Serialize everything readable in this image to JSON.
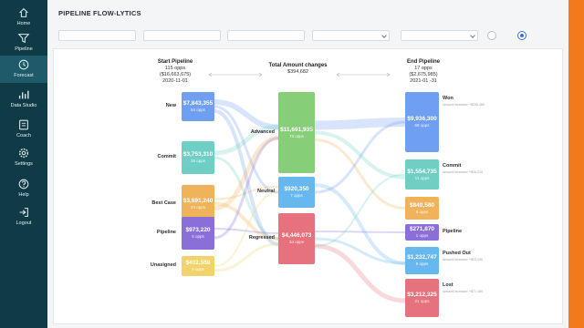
{
  "nav": [
    {
      "label": "Home",
      "icon": "home-icon"
    },
    {
      "label": "Pipeline",
      "icon": "filter-icon"
    },
    {
      "label": "Forecast",
      "icon": "clock-icon",
      "active": true
    },
    {
      "label": "Data Studio",
      "icon": "bar-chart-icon"
    },
    {
      "label": "Coach",
      "icon": "coach-icon"
    },
    {
      "label": "Settings",
      "icon": "gear-icon"
    },
    {
      "label": "Help",
      "icon": "help-icon"
    },
    {
      "label": "Logout",
      "icon": "logout-icon"
    }
  ],
  "title": "PIPELINE FLOW-LYTICS",
  "headers": {
    "start": {
      "title": "Start Pipeline",
      "opps": "115 opps",
      "amount": "($16,663,675)",
      "date": "2020-11-01"
    },
    "total": {
      "title": "Total Amount changes",
      "amount": "$394,682"
    },
    "end": {
      "title": "End Pipeline",
      "opps": "17 opps",
      "amount": "($2,675,985)",
      "date": "2021-01 -31"
    }
  },
  "start_nodes": [
    {
      "label": "New",
      "value": "$7,843,355",
      "count": "54 opps",
      "color": "#6e9ff0"
    },
    {
      "label": "Commit",
      "value": "$3,753,310",
      "count": "26 opps",
      "color": "#6fcfc4"
    },
    {
      "label": "Best Case",
      "value": "$3,691,240",
      "count": "24 opps",
      "color": "#f0b35b"
    },
    {
      "label": "Pipeline",
      "value": "$973,220",
      "count": "6 opps",
      "color": "#8a6fd8"
    },
    {
      "label": "Unasigned",
      "value": "$402,550",
      "count": "5 opps",
      "color": "#f2d36b"
    }
  ],
  "mid_nodes": [
    {
      "label": "Advanced",
      "value": "$11,691,935",
      "count": "78 opps",
      "color": "#86cf78"
    },
    {
      "label": "Neutral",
      "value": "$920,350",
      "count": "7 opps",
      "color": "#67b8ef"
    },
    {
      "label": "Regressed",
      "value": "$4,446,073",
      "count": "34 opps",
      "color": "#e5727c"
    }
  ],
  "end_nodes": [
    {
      "label": "Won",
      "value": "$9,936,300",
      "count": "69 opps",
      "sub": "Amount increase: +$295,460",
      "color": "#6e9ff0"
    },
    {
      "label": "Commit",
      "value": "$1,554,735",
      "count": "11 opps",
      "sub": "Amount increase: +$16,215",
      "color": "#6fcfc4"
    },
    {
      "label": "",
      "value": "$849,580",
      "count": "8 opps",
      "sub": "",
      "color": "#f0b35b"
    },
    {
      "label": "Pipeline",
      "value": "$271,870",
      "count": "1 opps",
      "sub": "",
      "color": "#8a6fd8"
    },
    {
      "label": "Pushed Out",
      "value": "$1,232,747",
      "count": "9 opps",
      "sub": "Amount increase: +$23,100",
      "color": "#67b8ef"
    },
    {
      "label": "Lost",
      "value": "$3,212,325",
      "count": "21 opps",
      "sub": "Amount increase: +$71,180",
      "color": "#e5727c"
    }
  ]
}
